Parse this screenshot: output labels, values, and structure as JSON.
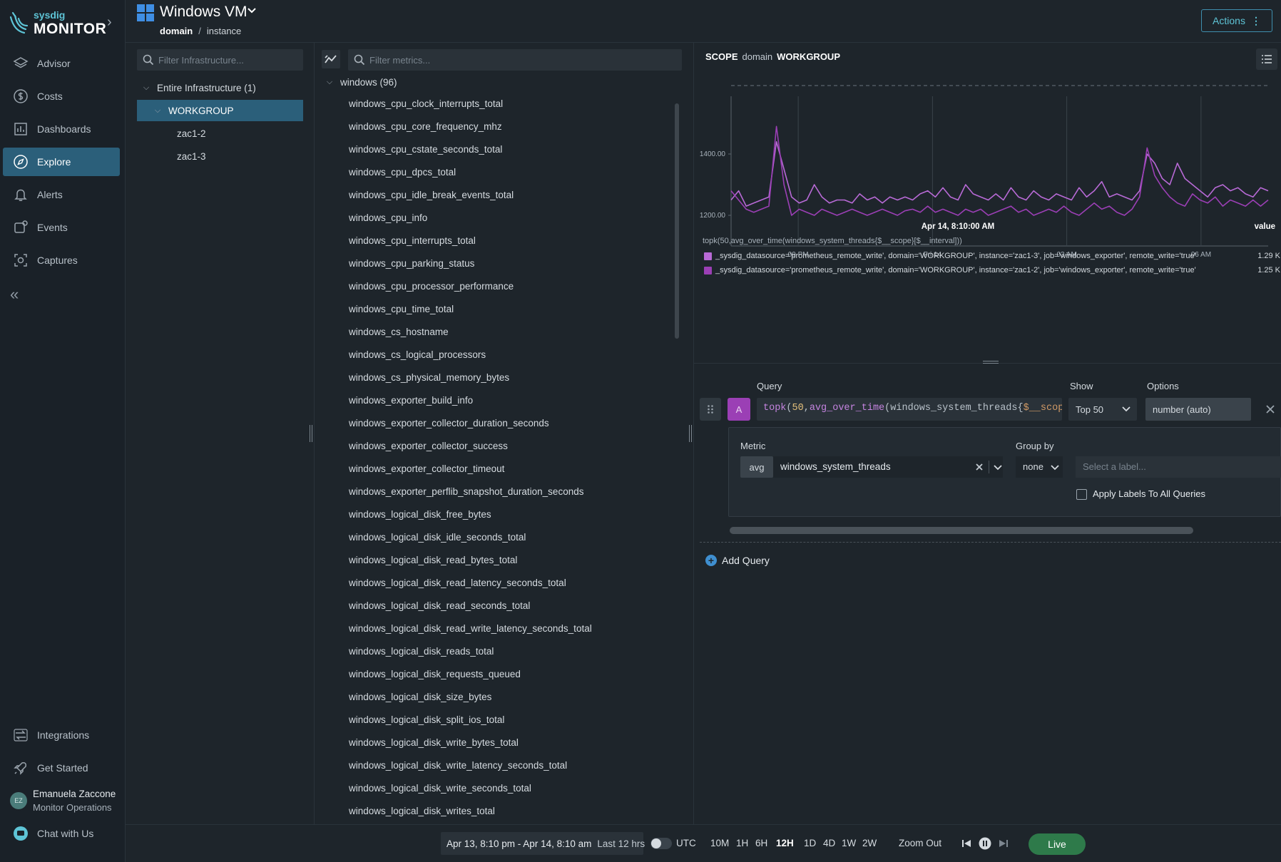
{
  "brand": {
    "sub": "sysdig",
    "main": "MONITOR"
  },
  "nav": {
    "items": [
      {
        "label": "Advisor",
        "icon": "layers-icon"
      },
      {
        "label": "Costs",
        "icon": "dollar-icon"
      },
      {
        "label": "Dashboards",
        "icon": "bar-chart-icon"
      },
      {
        "label": "Explore",
        "icon": "compass-icon",
        "active": true
      },
      {
        "label": "Alerts",
        "icon": "bell-icon"
      },
      {
        "label": "Events",
        "icon": "events-icon"
      },
      {
        "label": "Captures",
        "icon": "capture-icon"
      }
    ],
    "bottom_items": [
      {
        "label": "Integrations",
        "icon": "integrations-icon"
      },
      {
        "label": "Get Started",
        "icon": "rocket-icon"
      }
    ],
    "user": {
      "initials": "EZ",
      "name": "Emanuela Zaccone",
      "role": "Monitor Operations"
    },
    "chat_label": "Chat with Us"
  },
  "header": {
    "title": "Windows VM",
    "breadcrumb": [
      "domain",
      "instance"
    ],
    "actions_label": "Actions"
  },
  "infra": {
    "search_placeholder": "Filter Infrastructure...",
    "tree": [
      {
        "label": "Entire Infrastructure (1)",
        "level": 0,
        "expanded": true
      },
      {
        "label": "WORKGROUP",
        "level": 1,
        "expanded": true,
        "selected": true
      },
      {
        "label": "zac1-2",
        "level": 2
      },
      {
        "label": "zac1-3",
        "level": 2
      }
    ]
  },
  "metrics": {
    "search_placeholder": "Filter metrics...",
    "group_label": "windows (96)",
    "items": [
      "windows_cpu_clock_interrupts_total",
      "windows_cpu_core_frequency_mhz",
      "windows_cpu_cstate_seconds_total",
      "windows_cpu_dpcs_total",
      "windows_cpu_idle_break_events_total",
      "windows_cpu_info",
      "windows_cpu_interrupts_total",
      "windows_cpu_parking_status",
      "windows_cpu_processor_performance",
      "windows_cpu_time_total",
      "windows_cs_hostname",
      "windows_cs_logical_processors",
      "windows_cs_physical_memory_bytes",
      "windows_exporter_build_info",
      "windows_exporter_collector_duration_seconds",
      "windows_exporter_collector_success",
      "windows_exporter_collector_timeout",
      "windows_exporter_perflib_snapshot_duration_seconds",
      "windows_logical_disk_free_bytes",
      "windows_logical_disk_idle_seconds_total",
      "windows_logical_disk_read_bytes_total",
      "windows_logical_disk_read_latency_seconds_total",
      "windows_logical_disk_read_seconds_total",
      "windows_logical_disk_read_write_latency_seconds_total",
      "windows_logical_disk_reads_total",
      "windows_logical_disk_requests_queued",
      "windows_logical_disk_size_bytes",
      "windows_logical_disk_split_ios_total",
      "windows_logical_disk_write_bytes_total",
      "windows_logical_disk_write_latency_seconds_total",
      "windows_logical_disk_write_seconds_total",
      "windows_logical_disk_writes_total"
    ]
  },
  "scope": {
    "key": "SCOPE",
    "label": "domain",
    "value": "WORKGROUP"
  },
  "chart_data": {
    "type": "line",
    "ylim": [
      1100,
      1600
    ],
    "yticks": [
      {
        "value": 1200,
        "label": "1200.00"
      },
      {
        "value": 1400,
        "label": "1400.00"
      }
    ],
    "xticks": [
      {
        "t": 1.5,
        "label": "09 PM"
      },
      {
        "t": 4.5,
        "label": "Fri 14"
      },
      {
        "t": 7.5,
        "label": "03 AM"
      },
      {
        "t": 10.5,
        "label": "06 AM"
      }
    ],
    "x_range": [
      0,
      12
    ],
    "hover_time": "Apr 14, 8:10:00 AM",
    "value_header": "value",
    "query_text": "topk(50,avg_over_time(windows_system_threads{$__scope}[$__interval]))",
    "series": [
      {
        "name": "_sysdig_datasource='prometheus_remote_write', domain='WORKGROUP', instance='zac1-3', job='windows_exporter', remote_write='true'",
        "value_label": "1.29 K",
        "color": "#b86ad6",
        "values": [
          1250,
          1280,
          1230,
          1240,
          1250,
          1260,
          1440,
          1350,
          1260,
          1240,
          1250,
          1300,
          1260,
          1240,
          1250,
          1250,
          1240,
          1270,
          1250,
          1260,
          1240,
          1260,
          1250,
          1260,
          1250,
          1270,
          1280,
          1260,
          1290,
          1260,
          1250,
          1300,
          1270,
          1260,
          1250,
          1270,
          1250,
          1290,
          1260,
          1250,
          1280,
          1260,
          1250,
          1270,
          1260,
          1250,
          1290,
          1260,
          1280,
          1310,
          1260,
          1270,
          1260,
          1250,
          1280,
          1400,
          1370,
          1320,
          1300,
          1370,
          1320,
          1300,
          1280,
          1260,
          1290,
          1300,
          1280,
          1290,
          1270,
          1260,
          1290,
          1280
        ]
      },
      {
        "name": "_sysdig_datasource='prometheus_remote_write', domain='WORKGROUP', instance='zac1-2', job='windows_exporter', remote_write='true'",
        "value_label": "1.25 K",
        "color": "#9b3fb5",
        "values": [
          1280,
          1250,
          1220,
          1210,
          1220,
          1230,
          1490,
          1300,
          1200,
          1220,
          1210,
          1200,
          1220,
          1210,
          1200,
          1210,
          1220,
          1210,
          1200,
          1210,
          1220,
          1210,
          1200,
          1215,
          1220,
          1210,
          1230,
          1210,
          1220,
          1210,
          1200,
          1220,
          1210,
          1220,
          1200,
          1210,
          1220,
          1230,
          1210,
          1220,
          1200,
          1210,
          1220,
          1210,
          1230,
          1210,
          1200,
          1220,
          1240,
          1220,
          1230,
          1210,
          1200,
          1220,
          1260,
          1420,
          1330,
          1290,
          1260,
          1240,
          1230,
          1270,
          1250,
          1240,
          1260,
          1230,
          1250,
          1240,
          1230,
          1250,
          1230,
          1250
        ]
      }
    ]
  },
  "query": {
    "labels": {
      "query": "Query",
      "show": "Show",
      "options": "Options"
    },
    "letter": "A",
    "text_parts": [
      {
        "t": "topk",
        "c": "f"
      },
      {
        "t": "(",
        "c": "m"
      },
      {
        "t": "50",
        "c": "n"
      },
      {
        "t": ",",
        "c": "m"
      },
      {
        "t": "avg_over_time",
        "c": "f"
      },
      {
        "t": "(",
        "c": "m"
      },
      {
        "t": "windows_system_threads",
        "c": "m"
      },
      {
        "t": "{",
        "c": "m"
      },
      {
        "t": "$__scope",
        "c": "s"
      },
      {
        "t": "}",
        "c": "m"
      }
    ],
    "show_value": "Top 50",
    "options_value": "number (auto)",
    "metric_label": "Metric",
    "group_by_label": "Group by",
    "aggregation": "avg",
    "metric_value": "windows_system_threads",
    "group_value": "none",
    "label_placeholder": "Select a label...",
    "apply_labels": "Apply Labels To All Queries",
    "add_query": "Add Query"
  },
  "timebar": {
    "range": "Apr 13, 8:10 pm - Apr 14, 8:10 am",
    "last": "Last 12 hrs",
    "utc": "UTC",
    "presets": [
      "10M",
      "1H",
      "6H",
      "12H",
      "1D",
      "4D",
      "1W",
      "2W"
    ],
    "active_preset": "12H",
    "zoom_out": "Zoom Out",
    "live": "Live"
  }
}
